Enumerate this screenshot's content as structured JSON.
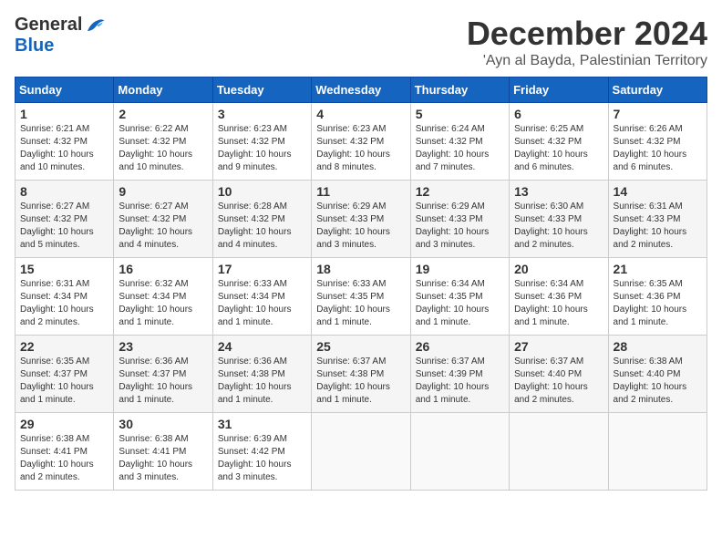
{
  "logo": {
    "general": "General",
    "blue": "Blue"
  },
  "title": {
    "month": "December 2024",
    "location": "'Ayn al Bayda, Palestinian Territory"
  },
  "weekdays": [
    "Sunday",
    "Monday",
    "Tuesday",
    "Wednesday",
    "Thursday",
    "Friday",
    "Saturday"
  ],
  "weeks": [
    [
      {
        "day": "1",
        "sunrise": "6:21 AM",
        "sunset": "4:32 PM",
        "daylight": "10 hours and 10 minutes."
      },
      {
        "day": "2",
        "sunrise": "6:22 AM",
        "sunset": "4:32 PM",
        "daylight": "10 hours and 10 minutes."
      },
      {
        "day": "3",
        "sunrise": "6:23 AM",
        "sunset": "4:32 PM",
        "daylight": "10 hours and 9 minutes."
      },
      {
        "day": "4",
        "sunrise": "6:23 AM",
        "sunset": "4:32 PM",
        "daylight": "10 hours and 8 minutes."
      },
      {
        "day": "5",
        "sunrise": "6:24 AM",
        "sunset": "4:32 PM",
        "daylight": "10 hours and 7 minutes."
      },
      {
        "day": "6",
        "sunrise": "6:25 AM",
        "sunset": "4:32 PM",
        "daylight": "10 hours and 6 minutes."
      },
      {
        "day": "7",
        "sunrise": "6:26 AM",
        "sunset": "4:32 PM",
        "daylight": "10 hours and 6 minutes."
      }
    ],
    [
      {
        "day": "8",
        "sunrise": "6:27 AM",
        "sunset": "4:32 PM",
        "daylight": "10 hours and 5 minutes."
      },
      {
        "day": "9",
        "sunrise": "6:27 AM",
        "sunset": "4:32 PM",
        "daylight": "10 hours and 4 minutes."
      },
      {
        "day": "10",
        "sunrise": "6:28 AM",
        "sunset": "4:32 PM",
        "daylight": "10 hours and 4 minutes."
      },
      {
        "day": "11",
        "sunrise": "6:29 AM",
        "sunset": "4:33 PM",
        "daylight": "10 hours and 3 minutes."
      },
      {
        "day": "12",
        "sunrise": "6:29 AM",
        "sunset": "4:33 PM",
        "daylight": "10 hours and 3 minutes."
      },
      {
        "day": "13",
        "sunrise": "6:30 AM",
        "sunset": "4:33 PM",
        "daylight": "10 hours and 2 minutes."
      },
      {
        "day": "14",
        "sunrise": "6:31 AM",
        "sunset": "4:33 PM",
        "daylight": "10 hours and 2 minutes."
      }
    ],
    [
      {
        "day": "15",
        "sunrise": "6:31 AM",
        "sunset": "4:34 PM",
        "daylight": "10 hours and 2 minutes."
      },
      {
        "day": "16",
        "sunrise": "6:32 AM",
        "sunset": "4:34 PM",
        "daylight": "10 hours and 1 minute."
      },
      {
        "day": "17",
        "sunrise": "6:33 AM",
        "sunset": "4:34 PM",
        "daylight": "10 hours and 1 minute."
      },
      {
        "day": "18",
        "sunrise": "6:33 AM",
        "sunset": "4:35 PM",
        "daylight": "10 hours and 1 minute."
      },
      {
        "day": "19",
        "sunrise": "6:34 AM",
        "sunset": "4:35 PM",
        "daylight": "10 hours and 1 minute."
      },
      {
        "day": "20",
        "sunrise": "6:34 AM",
        "sunset": "4:36 PM",
        "daylight": "10 hours and 1 minute."
      },
      {
        "day": "21",
        "sunrise": "6:35 AM",
        "sunset": "4:36 PM",
        "daylight": "10 hours and 1 minute."
      }
    ],
    [
      {
        "day": "22",
        "sunrise": "6:35 AM",
        "sunset": "4:37 PM",
        "daylight": "10 hours and 1 minute."
      },
      {
        "day": "23",
        "sunrise": "6:36 AM",
        "sunset": "4:37 PM",
        "daylight": "10 hours and 1 minute."
      },
      {
        "day": "24",
        "sunrise": "6:36 AM",
        "sunset": "4:38 PM",
        "daylight": "10 hours and 1 minute."
      },
      {
        "day": "25",
        "sunrise": "6:37 AM",
        "sunset": "4:38 PM",
        "daylight": "10 hours and 1 minute."
      },
      {
        "day": "26",
        "sunrise": "6:37 AM",
        "sunset": "4:39 PM",
        "daylight": "10 hours and 1 minute."
      },
      {
        "day": "27",
        "sunrise": "6:37 AM",
        "sunset": "4:40 PM",
        "daylight": "10 hours and 2 minutes."
      },
      {
        "day": "28",
        "sunrise": "6:38 AM",
        "sunset": "4:40 PM",
        "daylight": "10 hours and 2 minutes."
      }
    ],
    [
      {
        "day": "29",
        "sunrise": "6:38 AM",
        "sunset": "4:41 PM",
        "daylight": "10 hours and 2 minutes."
      },
      {
        "day": "30",
        "sunrise": "6:38 AM",
        "sunset": "4:41 PM",
        "daylight": "10 hours and 3 minutes."
      },
      {
        "day": "31",
        "sunrise": "6:39 AM",
        "sunset": "4:42 PM",
        "daylight": "10 hours and 3 minutes."
      },
      null,
      null,
      null,
      null
    ]
  ]
}
